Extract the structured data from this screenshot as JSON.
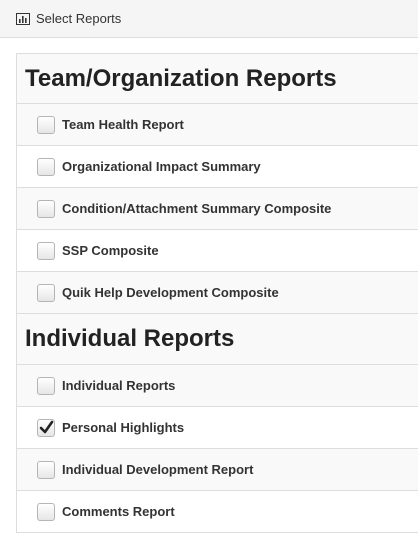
{
  "header": {
    "title": "Select Reports",
    "icon": "bar-chart-icon"
  },
  "sections": [
    {
      "title": "Team/Organization Reports",
      "items": [
        {
          "label": "Team Health Report",
          "checked": false
        },
        {
          "label": "Organizational Impact Summary",
          "checked": false
        },
        {
          "label": "Condition/Attachment Summary Composite",
          "checked": false
        },
        {
          "label": "SSP Composite",
          "checked": false
        },
        {
          "label": "Quik Help Development Composite",
          "checked": false
        }
      ]
    },
    {
      "title": "Individual Reports",
      "items": [
        {
          "label": "Individual Reports",
          "checked": false
        },
        {
          "label": "Personal Highlights",
          "checked": true
        },
        {
          "label": "Individual Development Report",
          "checked": false
        },
        {
          "label": "Comments Report",
          "checked": false
        }
      ]
    }
  ]
}
